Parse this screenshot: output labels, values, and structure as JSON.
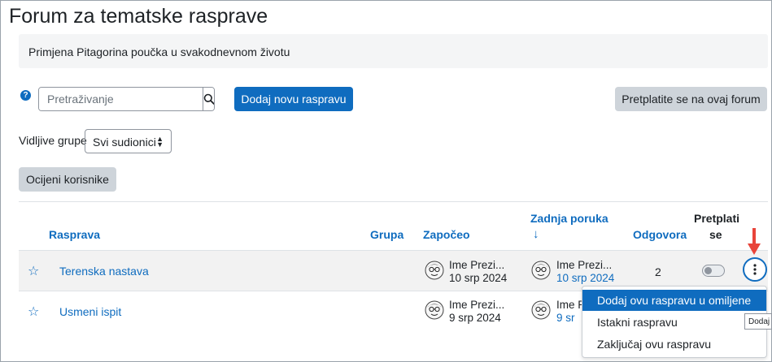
{
  "page": {
    "title": "Forum za tematske rasprave",
    "intro": "Primjena Pitagorina poučka u svakodnevnom životu"
  },
  "toolbar": {
    "help_icon": "question-circle-icon",
    "search_placeholder": "Pretraživanje",
    "add_discussion": "Dodaj novu raspravu",
    "subscribe": "Pretplatite se na ovaj forum"
  },
  "groups": {
    "label": "Vidljive grupe",
    "selected": "Svi sudionici"
  },
  "rate_users": "Ocijeni korisnike",
  "table": {
    "headers": {
      "discussion": "Rasprava",
      "group": "Grupa",
      "started_by": "Započeo",
      "last_post_line1": "Zadnja poruka",
      "last_post_sort": "↓",
      "replies": "Odgovora",
      "subscribe_line1": "Pretplati",
      "subscribe_line2": "se"
    },
    "rows": [
      {
        "title": "Terenska nastava",
        "starter_name": "Ime Prezi...",
        "started_date": "10 srp 2024",
        "last_name": "Ime Prezi...",
        "last_date": "10 srp 2024",
        "replies": "2"
      },
      {
        "title": "Usmeni ispit",
        "starter_name": "Ime Prezi...",
        "started_date": "9 srp 2024",
        "last_name": "Ime Prezi...",
        "last_date": "9 sr"
      }
    ]
  },
  "menu": {
    "items": [
      "Dodaj ovu raspravu u omiljene",
      "Istakni raspravu",
      "Zaključaj ovu raspravu"
    ]
  },
  "tooltip": "Dodaj",
  "colors": {
    "accent": "#0f6cbf",
    "annotation_arrow": "#e8443a",
    "highlight_row": "#f2f2f2"
  }
}
